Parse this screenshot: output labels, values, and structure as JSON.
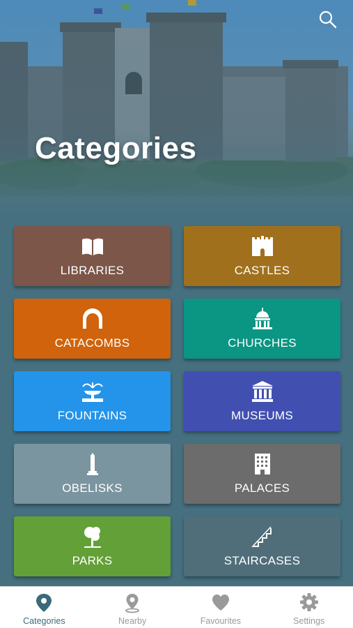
{
  "header": {
    "title": "Categories",
    "search_icon": "search-icon"
  },
  "categories": [
    {
      "label": "LIBRARIES",
      "icon": "book-icon",
      "color": "#7b5649"
    },
    {
      "label": "CASTLES",
      "icon": "castle-icon",
      "color": "#a0701d"
    },
    {
      "label": "CATACOMBS",
      "icon": "arch-icon",
      "color": "#d0630b"
    },
    {
      "label": "CHURCHES",
      "icon": "church-dome-icon",
      "color": "#0b9583"
    },
    {
      "label": "FOUNTAINS",
      "icon": "fountain-icon",
      "color": "#2394ea"
    },
    {
      "label": "MUSEUMS",
      "icon": "museum-icon",
      "color": "#4150b0"
    },
    {
      "label": "OBELISKS",
      "icon": "obelisk-icon",
      "color": "#7b95a0"
    },
    {
      "label": "PALACES",
      "icon": "building-icon",
      "color": "#6c6c6c"
    },
    {
      "label": "PARKS",
      "icon": "tree-icon",
      "color": "#63a038"
    },
    {
      "label": "STAIRCASES",
      "icon": "stairs-icon",
      "color": "#4f6e7a"
    }
  ],
  "tabs": [
    {
      "label": "Categories",
      "icon": "map-pin-icon",
      "active": true
    },
    {
      "label": "Nearby",
      "icon": "location-icon",
      "active": false
    },
    {
      "label": "Favourites",
      "icon": "heart-icon",
      "active": false
    },
    {
      "label": "Settings",
      "icon": "gear-icon",
      "active": false
    }
  ],
  "colors": {
    "background": "#46707f",
    "tab_active": "#3b6a79",
    "tab_inactive": "#9a9a9a"
  }
}
